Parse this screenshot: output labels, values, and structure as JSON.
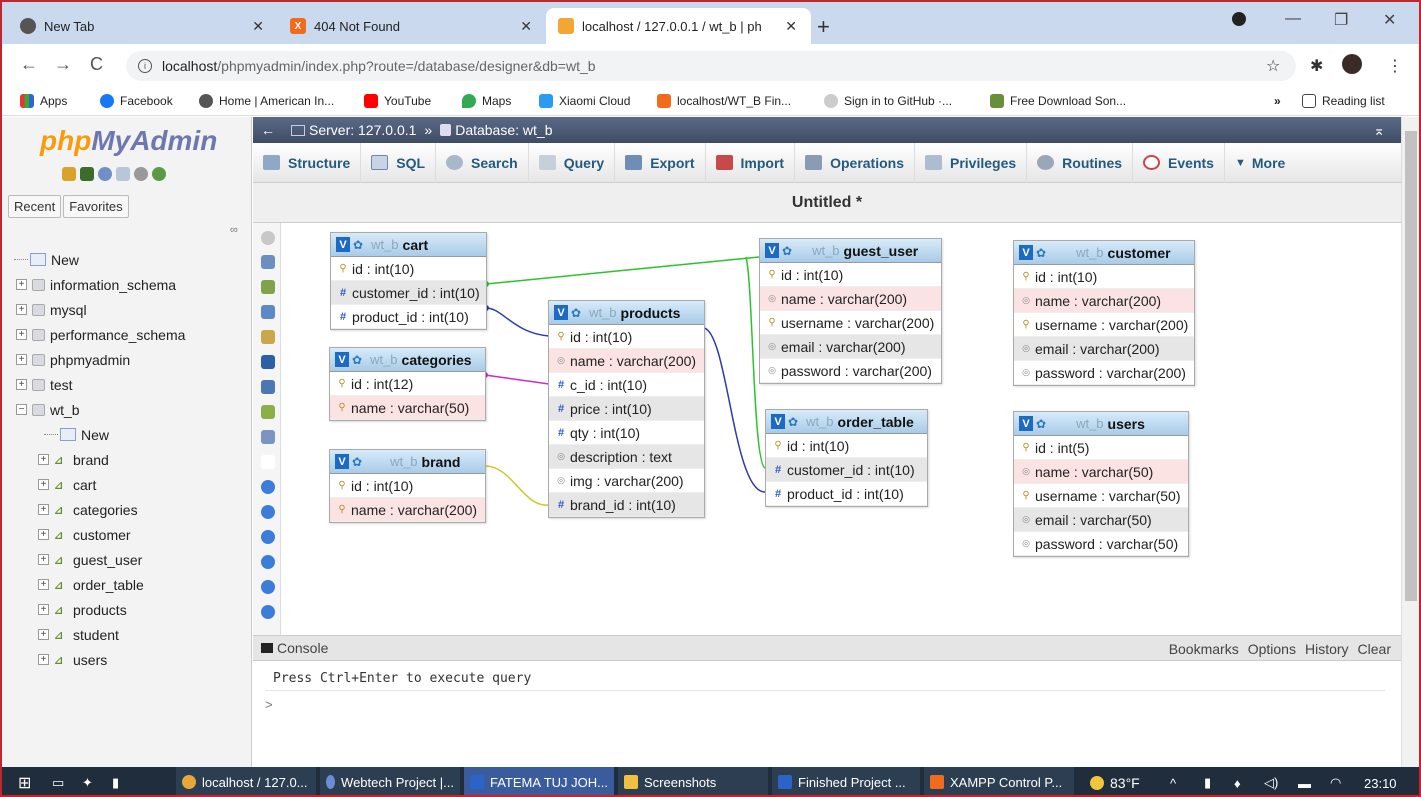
{
  "browser": {
    "tabs": [
      {
        "label": "New Tab",
        "active": false
      },
      {
        "label": "404 Not Found",
        "active": false
      },
      {
        "label": "localhost / 127.0.0.1 / wt_b | php",
        "active": true
      }
    ],
    "url_host": "localhost",
    "url_path": "/phpmyadmin/index.php?route=/database/designer&db=wt_b",
    "bookmarks": [
      "Apps",
      "Facebook",
      "Home | American In...",
      "YouTube",
      "Maps",
      "Xiaomi Cloud",
      "localhost/WT_B Fin...",
      "Sign in to GitHub ·...",
      "Free Download Son...",
      "Reading list"
    ]
  },
  "sidebar": {
    "logo_php": "php",
    "logo_myadmin": "MyAdmin",
    "recent": "Recent",
    "favorites": "Favorites",
    "databases": [
      {
        "label": "New",
        "type": "new"
      },
      {
        "label": "information_schema",
        "type": "db"
      },
      {
        "label": "mysql",
        "type": "db"
      },
      {
        "label": "performance_schema",
        "type": "db"
      },
      {
        "label": "phpmyadmin",
        "type": "db"
      },
      {
        "label": "test",
        "type": "db"
      },
      {
        "label": "wt_b",
        "type": "db-open"
      }
    ],
    "wt_b_items": [
      "New",
      "brand",
      "cart",
      "categories",
      "customer",
      "guest_user",
      "order_table",
      "products",
      "student",
      "users"
    ]
  },
  "breadcrumb": {
    "server": "Server: 127.0.0.1",
    "sep": "»",
    "database": "Database: wt_b"
  },
  "menu": [
    "Structure",
    "SQL",
    "Search",
    "Query",
    "Export",
    "Import",
    "Operations",
    "Privileges",
    "Routines",
    "Events",
    "More"
  ],
  "designer_title": "Untitled *",
  "db_prefix": "wt_b",
  "tables": {
    "cart": {
      "name": "cart",
      "cols": [
        [
          "key",
          "id : int(10)",
          ""
        ],
        [
          "hash",
          "customer_id : int(10)",
          "grey"
        ],
        [
          "hash",
          "product_id : int(10)",
          ""
        ]
      ]
    },
    "categories": {
      "name": "categories",
      "cols": [
        [
          "key",
          "id : int(12)",
          ""
        ],
        [
          "key",
          "name : varchar(50)",
          "pink"
        ]
      ]
    },
    "brand": {
      "name": "brand",
      "cols": [
        [
          "key",
          "id : int(10)",
          ""
        ],
        [
          "key",
          "name : varchar(200)",
          "pink"
        ]
      ]
    },
    "products": {
      "name": "products",
      "cols": [
        [
          "key",
          "id : int(10)",
          ""
        ],
        [
          "circ",
          "name : varchar(200)",
          "pink"
        ],
        [
          "hash",
          "c_id : int(10)",
          ""
        ],
        [
          "hash",
          "price : int(10)",
          "grey"
        ],
        [
          "hash",
          "qty : int(10)",
          ""
        ],
        [
          "circ",
          "description : text",
          "grey"
        ],
        [
          "circ",
          "img : varchar(200)",
          ""
        ],
        [
          "hash",
          "brand_id : int(10)",
          "grey"
        ]
      ]
    },
    "guest_user": {
      "name": "guest_user",
      "cols": [
        [
          "key",
          "id : int(10)",
          ""
        ],
        [
          "circ",
          "name : varchar(200)",
          "pink"
        ],
        [
          "key",
          "username : varchar(200)",
          ""
        ],
        [
          "circ",
          "email : varchar(200)",
          "grey"
        ],
        [
          "circ",
          "password : varchar(200)",
          ""
        ]
      ]
    },
    "order_table": {
      "name": "order_table",
      "cols": [
        [
          "key",
          "id : int(10)",
          ""
        ],
        [
          "hash",
          "customer_id : int(10)",
          "grey"
        ],
        [
          "hash",
          "product_id : int(10)",
          ""
        ]
      ]
    },
    "customer": {
      "name": "customer",
      "cols": [
        [
          "key",
          "id : int(10)",
          ""
        ],
        [
          "circ",
          "name : varchar(200)",
          "pink"
        ],
        [
          "key",
          "username : varchar(200)",
          ""
        ],
        [
          "circ",
          "email : varchar(200)",
          "grey"
        ],
        [
          "circ",
          "password : varchar(200)",
          ""
        ]
      ]
    },
    "users": {
      "name": "users",
      "cols": [
        [
          "key",
          "id : int(5)",
          ""
        ],
        [
          "circ",
          "name : varchar(50)",
          "pink"
        ],
        [
          "key",
          "username : varchar(50)",
          ""
        ],
        [
          "circ",
          "email : varchar(50)",
          "grey"
        ],
        [
          "circ",
          "password : varchar(50)",
          ""
        ]
      ]
    }
  },
  "console": {
    "title": "Console",
    "links": [
      "Bookmarks",
      "Options",
      "History",
      "Clear"
    ],
    "message": "Press Ctrl+Enter to execute query",
    "prompt": ">"
  },
  "taskbar": {
    "apps": [
      "localhost / 127.0...",
      "Webtech Project |...",
      "FATEMA TUJ JOH...",
      "Screenshots",
      "Finished Project ...",
      "XAMPP Control P..."
    ],
    "temp": "83°F",
    "time": "23:10"
  }
}
